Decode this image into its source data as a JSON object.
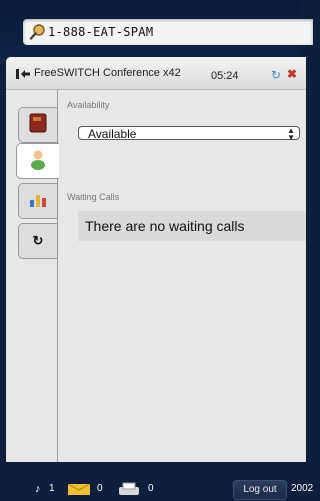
{
  "search": {
    "value": "1-888-EAT-SPAM"
  },
  "conference": {
    "title": "FreeSWITCH Conference x42",
    "timer": "05:24"
  },
  "tabs": [
    {
      "name": "phonebook-icon"
    },
    {
      "name": "user-icon"
    },
    {
      "name": "chart-icon"
    },
    {
      "name": "refresh-icon"
    }
  ],
  "availability": {
    "label": "Availability",
    "selected": "Available"
  },
  "waiting_calls": {
    "label": "Waiting Calls",
    "message": "There are no waiting calls"
  },
  "status_bar": {
    "calls_count": "1",
    "messages_count": "0",
    "fax_count": "0",
    "logout_label": "Log out",
    "year": "2002"
  },
  "colors": {
    "background": "#0d1f3c",
    "refresh": "#3a8fd4",
    "close": "#c2372c"
  }
}
